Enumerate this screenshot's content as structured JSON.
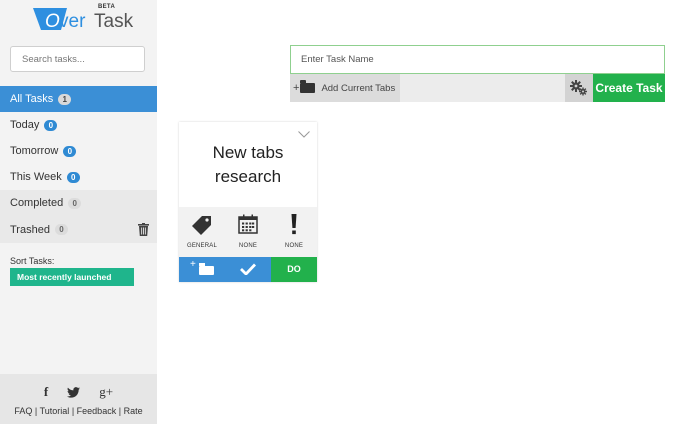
{
  "app": {
    "logo_text": "OverTask",
    "beta_label": "BETA"
  },
  "sidebar": {
    "search_placeholder": "Search tasks...",
    "items": [
      {
        "label": "All Tasks",
        "count": "1"
      },
      {
        "label": "Today",
        "count": "0"
      },
      {
        "label": "Tomorrow",
        "count": "0"
      },
      {
        "label": "This Week",
        "count": "0"
      },
      {
        "label": "Completed",
        "count": "0"
      },
      {
        "label": "Trashed",
        "count": "0"
      }
    ],
    "sort_label": "Sort Tasks:",
    "sort_value": "Most recently launched",
    "social": {
      "facebook": "f",
      "twitter": "twitter-icon",
      "google": "g+"
    },
    "links": {
      "faq": "FAQ",
      "tutorial": "Tutorial",
      "feedback": "Feedback",
      "rate": "Rate",
      "separator": "|"
    }
  },
  "composer": {
    "placeholder": "Enter Task Name",
    "add_tabs_label": "Add Current Tabs",
    "create_label": "Create Task"
  },
  "task_card": {
    "title": "New tabs research",
    "tag_label": "GENERAL",
    "date_label": "NONE",
    "priority_label": "NONE",
    "do_label": "DO"
  },
  "colors": {
    "accent_blue": "#3b8fd6",
    "accent_green": "#22b14c",
    "teal": "#1fb58c"
  },
  "icons": [
    "search-icon",
    "trash-icon",
    "folder-icon",
    "gear-icon",
    "tag-icon",
    "calendar-icon",
    "exclamation-icon",
    "check-icon",
    "chevron-down-icon",
    "facebook-icon",
    "twitter-icon",
    "google-plus-icon"
  ]
}
